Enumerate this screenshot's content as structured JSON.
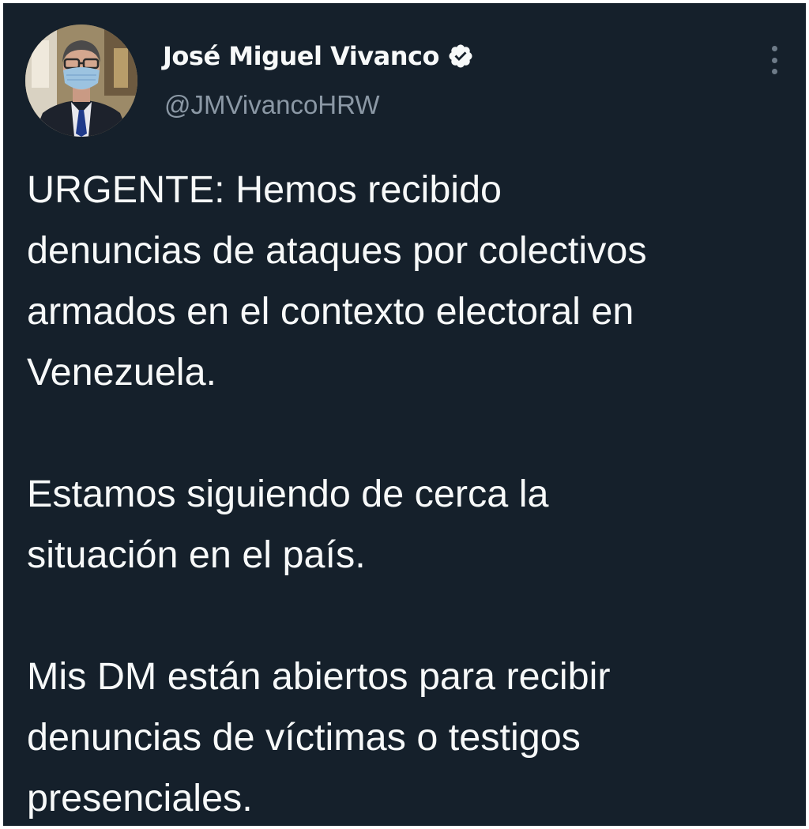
{
  "author": {
    "display_name": "José Miguel Vivanco",
    "handle": "@JMVivancoHRW",
    "verified_icon": "verified-badge-icon",
    "avatar_icon": "profile-photo"
  },
  "tweet": {
    "paragraphs": [
      [
        "URGENTE: Hemos recibido",
        "denuncias de ataques por colectivos",
        "armados en el contexto electoral en",
        "Venezuela."
      ],
      [
        "Estamos siguiendo de cerca la",
        "situación en el país."
      ],
      [
        "Mis DM están abiertos para recibir",
        "denuncias de víctimas o testigos",
        "presenciales."
      ]
    ]
  },
  "menu": {
    "icon": "more-vertical-icon"
  },
  "colors": {
    "background": "#15202b",
    "text": "#f7f9f9",
    "secondary_text": "#8b98a5"
  }
}
